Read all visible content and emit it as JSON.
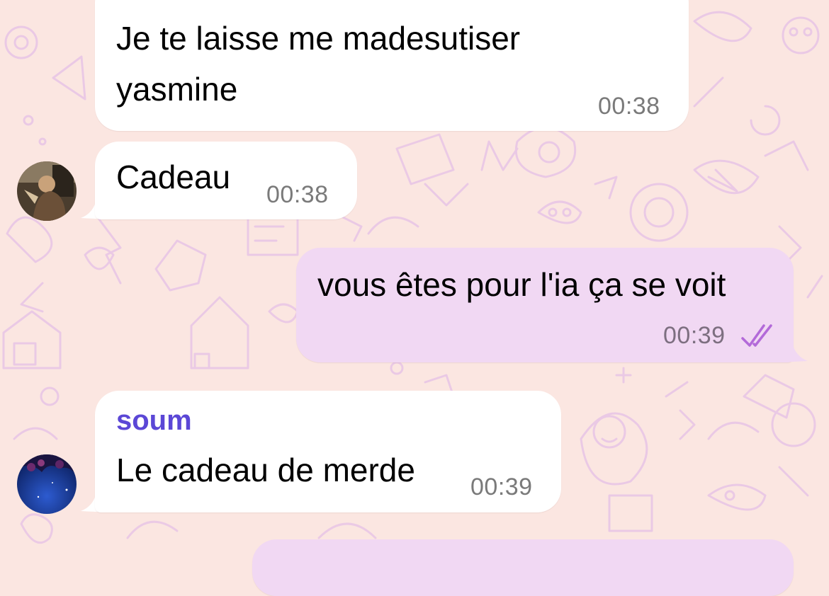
{
  "colors": {
    "background": "#fbe6e1",
    "incoming_bubble": "#ffffff",
    "outgoing_bubble": "#f1d8f3",
    "sender_name": "#5b47d6",
    "read_ticks": "#b36ad9",
    "timestamp": "#7a7a7a"
  },
  "messages": [
    {
      "direction": "incoming",
      "text_line1": "Je te laisse me madesutiser",
      "text_line2": "yasmine",
      "time": "00:38"
    },
    {
      "direction": "incoming",
      "avatar_icon": "avatar-photo-person-icon",
      "text": "Cadeau",
      "time": "00:38"
    },
    {
      "direction": "outgoing",
      "text": "vous êtes pour l'ia ça se voit",
      "time": "00:39",
      "status_icon": "double-check-read-icon"
    },
    {
      "direction": "incoming",
      "sender": "soum",
      "avatar_icon": "avatar-photo-night-sky-icon",
      "text": "Le cadeau de merde",
      "time": "00:39"
    }
  ]
}
